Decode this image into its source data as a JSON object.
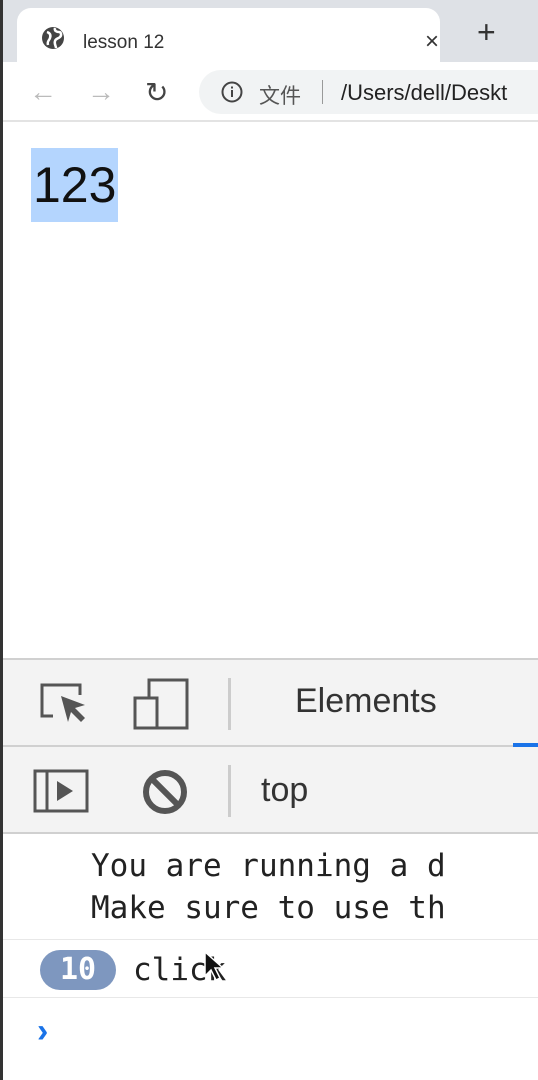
{
  "browser": {
    "tab_title": "lesson 12",
    "tab_close": "×",
    "new_tab": "+",
    "back": "←",
    "forward": "→",
    "reload": "↻",
    "address_label": "文件",
    "address_url": "/Users/dell/Deskt"
  },
  "page": {
    "selected_text": "123"
  },
  "devtools": {
    "tab_elements": "Elements",
    "context": "top",
    "messages": [
      "You are running a d",
      "Make sure to use th"
    ],
    "log": {
      "count": "10",
      "text": "click"
    },
    "prompt": "›",
    "accent": "#1a73e8",
    "badge_color": "#7e97bf"
  }
}
